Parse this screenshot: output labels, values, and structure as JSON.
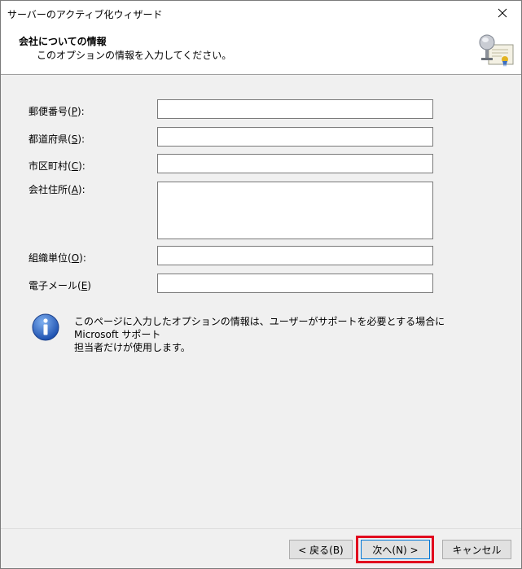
{
  "window": {
    "title": "サーバーのアクティブ化ウィザード"
  },
  "header": {
    "title": "会社についての情報",
    "subtitle": "このオプションの情報を入力してください。"
  },
  "form": {
    "postal_code": {
      "label": "郵便番号(",
      "accel": "P",
      "suffix": "):",
      "value": ""
    },
    "prefecture": {
      "label": "都道府県(",
      "accel": "S",
      "suffix": "):",
      "value": ""
    },
    "city": {
      "label": "市区町村(",
      "accel": "C",
      "suffix": "):",
      "value": ""
    },
    "address": {
      "label": "会社住所(",
      "accel": "A",
      "suffix": "):",
      "value": ""
    },
    "organization": {
      "label": "組織単位(",
      "accel": "O",
      "suffix": "):",
      "value": ""
    },
    "email": {
      "label": "電子メール(",
      "accel": "E",
      "suffix": ")",
      "value": ""
    }
  },
  "info": {
    "icon": "info-icon",
    "line1": "このページに入力したオプションの情報は、ユーザーがサポートを必要とする場合に Microsoft サポート",
    "line2": "担当者だけが使用します。"
  },
  "buttons": {
    "back": "< 戻る(B)",
    "next": "次へ(N) >",
    "cancel": "キャンセル"
  },
  "colors": {
    "highlight": "#e1001e",
    "accent": "#0078d7"
  }
}
